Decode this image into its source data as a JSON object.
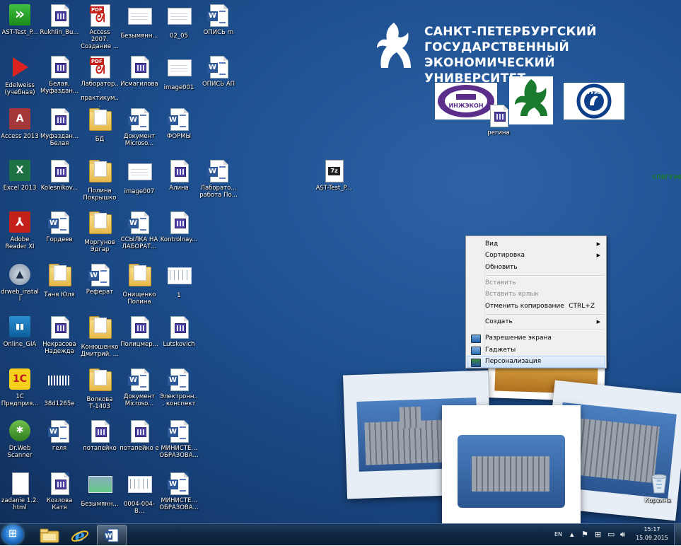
{
  "branding": {
    "line1": "САНКТ-ПЕТЕРБУРГСКИЙ",
    "line2": "ГОСУДАРСТВЕННЫЙ",
    "line3": "ЭКОНОМИЧЕСКИЙ УНИВЕРСИТЕТ",
    "logo_engecon": "ИНЖЭКОН",
    "logo_spbgief": "СПбГУЭФ",
    "logo_gues": "ГУЭС"
  },
  "icons": [
    {
      "label": "AST-Test_P...",
      "type": "ast"
    },
    {
      "label": "Edelweiss (учебная)",
      "type": "edel"
    },
    {
      "label": "Access 2013",
      "type": "access"
    },
    {
      "label": "Excel 2013",
      "type": "excel"
    },
    {
      "label": "Adobe Reader XI",
      "type": "reader"
    },
    {
      "label": "drweb_install",
      "type": "drweb"
    },
    {
      "label": "Online_GIA",
      "type": "gia"
    },
    {
      "label": "1С Предприя...",
      "type": "onec"
    },
    {
      "label": "Dr.Web Scanner",
      "type": "scanner"
    },
    {
      "label": "zadanie 1.2. html",
      "type": "blank"
    },
    {
      "label": "Rukhlin_Bu...",
      "type": "app"
    },
    {
      "label": "Белая, Муфаздан...",
      "type": "app"
    },
    {
      "label": "Муфаздан... Белая",
      "type": "app"
    },
    {
      "label": "Kolesnikov...",
      "type": "app"
    },
    {
      "label": "Гордеев",
      "type": "word"
    },
    {
      "label": "Таня Юля",
      "type": "folder"
    },
    {
      "label": "Некрасова Надежда",
      "type": "app"
    },
    {
      "label": "38d1265e",
      "type": "barcode"
    },
    {
      "label": "геля",
      "type": "word"
    },
    {
      "label": "Козлова Катя",
      "type": "app"
    },
    {
      "label": "Access 2007. Создание ...",
      "type": "pdf"
    },
    {
      "label": "Лаборатор... практикум...",
      "type": "pdf"
    },
    {
      "label": "БД",
      "type": "folder"
    },
    {
      "label": "Полина Покрышко",
      "type": "folder"
    },
    {
      "label": "Моргунов Эдгар",
      "type": "folder"
    },
    {
      "label": "Реферат",
      "type": "word"
    },
    {
      "label": "Конюшенко Дмитрий, ...",
      "type": "folder"
    },
    {
      "label": "Волкова Т-1403",
      "type": "folder"
    },
    {
      "label": "потапейко",
      "type": "app"
    },
    {
      "label": "Безымянн...",
      "type": "photo"
    },
    {
      "label": "Безымянн...",
      "type": "imgthumb"
    },
    {
      "label": "Исмагилова",
      "type": "app"
    },
    {
      "label": "Документ Microso...",
      "type": "word"
    },
    {
      "label": "image007",
      "type": "imgthumb"
    },
    {
      "label": "ССЫЛКА НА ЛАБОРАТ...",
      "type": "word"
    },
    {
      "label": "Онищенко Полина",
      "type": "folder"
    },
    {
      "label": "Полицмер...",
      "type": "app"
    },
    {
      "label": "Документ Microso...",
      "type": "word"
    },
    {
      "label": "потапейко е",
      "type": "app"
    },
    {
      "label": "0004-004-В...",
      "type": "xls"
    },
    {
      "label": "02_05",
      "type": "imgthumb"
    },
    {
      "label": "image001",
      "type": "imgthumb"
    },
    {
      "label": "ФОРМЫ",
      "type": "word"
    },
    {
      "label": "Алина",
      "type": "app"
    },
    {
      "label": "Kontrolnay...",
      "type": "app"
    },
    {
      "label": "1",
      "type": "xls"
    },
    {
      "label": "Lutskovich",
      "type": "app"
    },
    {
      "label": "Электронн... конспект",
      "type": "word"
    },
    {
      "label": "МИНИСТЕ... ОБРАЗОВА...",
      "type": "word"
    },
    {
      "label": "МИНИСТЕ... ОБРАЗОВА...",
      "type": "word"
    },
    {
      "label": "ОПИСЬ rn",
      "type": "word"
    },
    {
      "label": "ОПИСЬ АП",
      "type": "word"
    },
    {
      "label": "Лаборато... работа По...",
      "type": "word"
    },
    {
      "label": "AST-Test_P...",
      "type": "sevenz"
    },
    {
      "label": "регина",
      "type": "app"
    },
    {
      "label": "Корзина",
      "type": "bin"
    }
  ],
  "context_menu": {
    "items": [
      {
        "label": "Вид",
        "submenu": true
      },
      {
        "label": "Сортировка",
        "submenu": true
      },
      {
        "label": "Обновить"
      },
      {
        "label": "Вставить",
        "disabled": true
      },
      {
        "label": "Вставить ярлык",
        "disabled": true
      },
      {
        "label": "Отменить копирование",
        "shortcut": "CTRL+Z"
      },
      {
        "label": "Создать",
        "submenu": true
      },
      {
        "label": "Разрешение экрана",
        "icon": "display-icon"
      },
      {
        "label": "Гаджеты",
        "icon": "gadgets-icon"
      },
      {
        "label": "Персонализация",
        "icon": "personalize-icon",
        "highlighted": true
      }
    ]
  },
  "taskbar": {
    "language": "EN",
    "time": "15:17",
    "date": "15.09.2015",
    "pinned": [
      "explorer-icon",
      "ie-icon",
      "word-icon"
    ]
  },
  "colors": {
    "desktop_bg": "#1d4f8f",
    "menu_bg": "#f0f0f0",
    "menu_highlight": "#cfe2f6",
    "taskbar_bg": "#0e2742"
  }
}
